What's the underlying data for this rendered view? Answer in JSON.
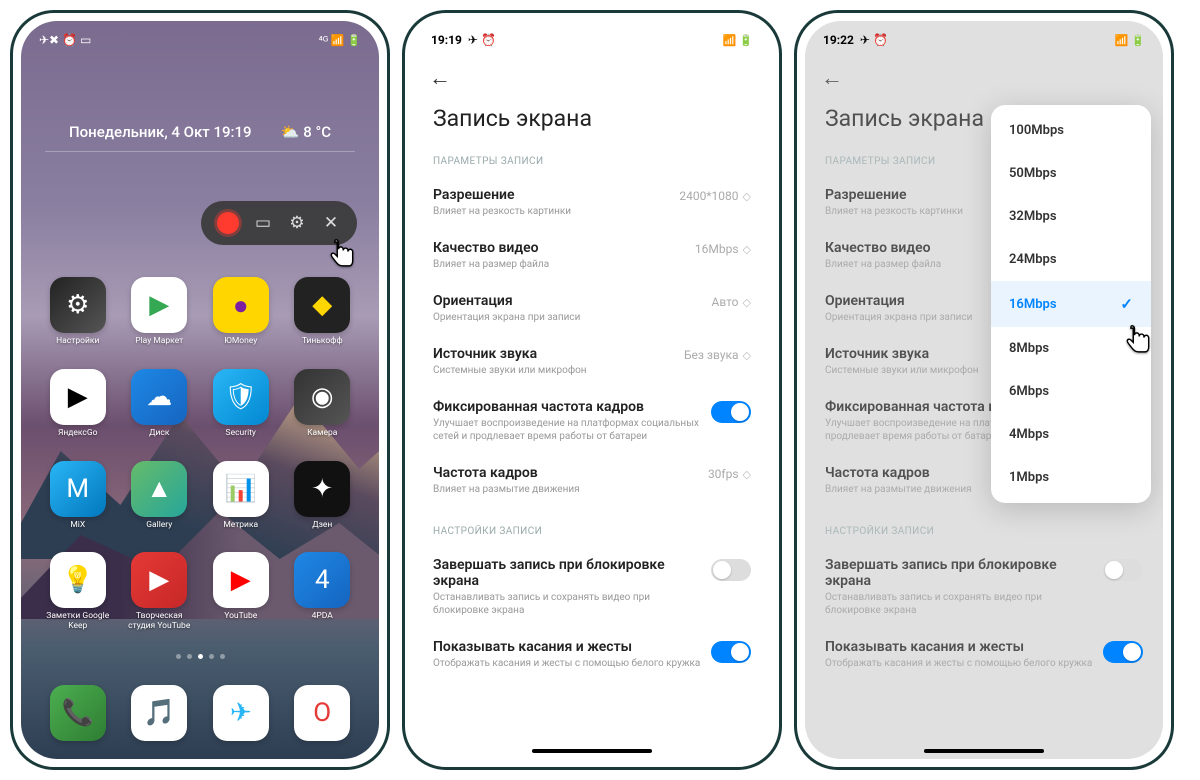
{
  "phone1": {
    "status_time": "",
    "status_icons_left": "✈✖ ⏰ ▭",
    "status_icons_right": "⁴ᴳ 📶 🔋",
    "dateline": "Понедельник, 4 Окт  19:19",
    "weather_icon": "⛅",
    "weather_temp": "8 °C",
    "recorder": {
      "folder": "folder-icon",
      "settings": "gear-icon",
      "close": "close-icon"
    },
    "apps": [
      {
        "label": "Настройки",
        "bg": "linear-gradient(135deg,#222,#555)",
        "glyph": "⚙"
      },
      {
        "label": "Play Маркет",
        "bg": "#fff",
        "glyph": "▶",
        "glyphColor": "#34a853"
      },
      {
        "label": "ЮMoney",
        "bg": "#ffd600",
        "glyph": "●",
        "glyphColor": "#7b1fa2"
      },
      {
        "label": "Тинькофф",
        "bg": "#222",
        "glyph": "◆",
        "glyphColor": "#ffd600"
      },
      {
        "label": "ЯндексGo",
        "bg": "#fff",
        "glyph": "▶",
        "glyphColor": "#000"
      },
      {
        "label": "Диск",
        "bg": "linear-gradient(135deg,#1e88e5,#1565c0)",
        "glyph": "☁"
      },
      {
        "label": "Security",
        "bg": "linear-gradient(135deg,#29b6f6,#0288d1)",
        "glyph": "🛡"
      },
      {
        "label": "Камера",
        "bg": "linear-gradient(135deg,#333,#555)",
        "glyph": "◉"
      },
      {
        "label": "MiX",
        "bg": "linear-gradient(135deg,#29b6f6,#0277bd)",
        "glyph": "M"
      },
      {
        "label": "Gallery",
        "bg": "linear-gradient(135deg,#66bb6a,#26a69a)",
        "glyph": "▲"
      },
      {
        "label": "Метрика",
        "bg": "#fff",
        "glyph": "📊",
        "glyphColor": "#333"
      },
      {
        "label": "Дзен",
        "bg": "#111",
        "glyph": "✦"
      },
      {
        "label": "Заметки Google Keep",
        "bg": "#fff",
        "glyph": "💡",
        "glyphColor": "#fbbc04"
      },
      {
        "label": "Творческая студия YouTube",
        "bg": "linear-gradient(135deg,#e53935,#c62828)",
        "glyph": "▶"
      },
      {
        "label": "YouTube",
        "bg": "#fff",
        "glyph": "▶",
        "glyphColor": "#ff0000"
      },
      {
        "label": "4PDA",
        "bg": "linear-gradient(135deg,#1e88e5,#1565c0)",
        "glyph": "4"
      }
    ],
    "dock": [
      {
        "bg": "linear-gradient(135deg,#4caf50,#2e7d32)",
        "glyph": "📞"
      },
      {
        "bg": "#fff",
        "glyph": "🎵",
        "glyphColor": "#ff3d00"
      },
      {
        "bg": "#fff",
        "glyph": "✈",
        "glyphColor": "#29b6f6"
      },
      {
        "bg": "#fff",
        "glyph": "O",
        "glyphColor": "#e53935"
      }
    ]
  },
  "phone2": {
    "status_time": "19:19",
    "status_icons_left": "✈ ⏰",
    "status_icons_right": "📶 🔋",
    "title": "Запись экрана",
    "section1": "ПАРАМЕТРЫ ЗАПИСИ",
    "section2": "НАСТРОЙКИ ЗАПИСИ",
    "items": {
      "resolution": {
        "title": "Разрешение",
        "sub": "Влияет на резкость картинки",
        "val": "2400*1080"
      },
      "quality": {
        "title": "Качество видео",
        "sub": "Влияет на размер файла",
        "val": "16Mbps"
      },
      "orientation": {
        "title": "Ориентация",
        "sub": "Ориентация экрана при записи",
        "val": "Авто"
      },
      "audio": {
        "title": "Источник звука",
        "sub": "Системные звуки или микрофон",
        "val": "Без звука"
      },
      "fixedfps": {
        "title": "Фиксированная частота кадров",
        "sub": "Улучшает воспроизведение на платформах социальных сетей и продлевает время работы от батареи",
        "on": true
      },
      "fps": {
        "title": "Частота кадров",
        "sub": "Влияет на размытие движения",
        "val": "30fps"
      },
      "lock": {
        "title": "Завершать запись при блокировке экрана",
        "sub": "Останавливать запись и сохранять видео при блокировке экрана",
        "on": false
      },
      "touches": {
        "title": "Показывать касания и жесты",
        "sub": "Отображать касания и жесты с помощью белого кружка",
        "on": true
      }
    }
  },
  "phone3": {
    "status_time": "19:22",
    "status_icons_left": "✈ ⏰",
    "status_icons_right": "📶 🔋",
    "title": "Запись экрана",
    "section1": "ПАРАМЕТРЫ ЗАПИСИ",
    "section2": "НАСТРОЙКИ ЗАПИСИ",
    "items": {
      "resolution": {
        "title": "Разрешение",
        "sub": "Влияет на резкость картинки"
      },
      "quality": {
        "title": "Качество видео",
        "sub": "Влияет на размер файла"
      },
      "orientation": {
        "title": "Ориентация",
        "sub": "Ориентация экрана при записи"
      },
      "audio": {
        "title": "Источник звука",
        "sub": "Системные звуки или микрофон"
      },
      "fixedfps": {
        "title": "Фиксированная частота кадров",
        "sub": "Улучшает воспроизведение на платформах социальных сетей и продлевает время работы от батареи"
      },
      "fps": {
        "title": "Частота кадров",
        "sub": "Влияет на размытие движения",
        "val": "30fps"
      },
      "lock": {
        "title": "Завершать запись при блокировке экрана",
        "sub": "Останавливать запись и сохранять видео при блокировке экрана",
        "on": false
      },
      "touches": {
        "title": "Показывать касания и жесты",
        "sub": "Отображать касания и жесты с помощью белого кружка",
        "on": true
      }
    },
    "popup_options": [
      "100Mbps",
      "50Mbps",
      "32Mbps",
      "24Mbps",
      "16Mbps",
      "8Mbps",
      "6Mbps",
      "4Mbps",
      "1Mbps"
    ],
    "popup_selected": "16Mbps"
  }
}
